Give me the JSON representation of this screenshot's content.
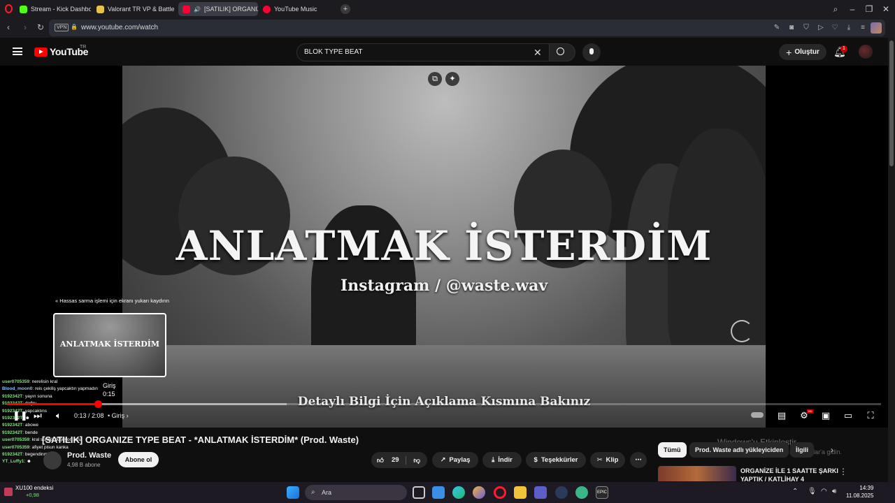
{
  "browser": {
    "tabs": [
      {
        "label": "Stream - Kick Dashboard",
        "color": "#53fc18",
        "active": false
      },
      {
        "label": "Valorant TR VP & Battle Pa",
        "color": "#e8c14a",
        "active": false
      },
      {
        "label": "[SATILIK] ORGANIZE T",
        "color": "#ff0033",
        "active": true
      },
      {
        "label": "YouTube Music",
        "color": "#ff0033",
        "active": false
      }
    ],
    "vpn_label": "VPN",
    "url": "www.youtube.com/watch"
  },
  "youtube": {
    "logo_text": "YouTube",
    "country": "TR",
    "search_value": "BLOK TYPE BEAT",
    "create_label": "Oluştur",
    "notification_count": "1"
  },
  "video": {
    "title_overlay": "ANLATMAK İSTERDİM",
    "subtitle_overlay": "Instagram / @waste.wav",
    "footer_overlay": "Detaylı Bilgi İçin Açıklama Kısmına Bakınız",
    "preview_hint": "Hassas sarma işlemi için ekranı yukarı kaydırın",
    "preview_title": "ANLATMAK İSTERDİM",
    "preview_chapter": "Giriş",
    "preview_time": "0:15",
    "current_time": "0:13 / 2:08",
    "chapter": "Giriş",
    "progress": 0.104,
    "buffered": 0.32
  },
  "chat": [
    {
      "user": "user0705359",
      "msg": ": nerelisin kral",
      "color": "#7ee37e"
    },
    {
      "user": "Blood_moon0",
      "msg": ": reis çekiliş yapcaktın yapmadın",
      "color": "#7ec8ff"
    },
    {
      "user": "9192342T",
      "msg": ": yayın sonuna",
      "color": "#7ee37e"
    },
    {
      "user": "9192342T",
      "msg": ": doğru",
      "color": "#7ee37e"
    },
    {
      "user": "9192342T",
      "msg": ": yapcaktıns",
      "color": "#7ee37e"
    },
    {
      "user": "9192342T",
      "msg": ": ☻",
      "color": "#7ee37e"
    },
    {
      "user": "9192342T",
      "msg": ": abowe",
      "color": "#7ee37e"
    },
    {
      "user": "9192342T",
      "msg": ": bende",
      "color": "#7ee37e"
    },
    {
      "user": "user0705359",
      "msg": ": kral sürekli düşüyon ama",
      "color": "#7ee37e"
    },
    {
      "user": "user0705359",
      "msg": ": afiyet pisun kanka",
      "color": "#7ee37e"
    },
    {
      "user": "9192342T",
      "msg": ": begendinmi",
      "color": "#7ee37e"
    },
    {
      "user": "YT_Luffy1",
      "msg": ": ☻",
      "color": "#7ee37e"
    }
  ],
  "meta": {
    "title": "[SATILIK] ORGANIZE TYPE BEAT - *ANLATMAK İSTERDİM* (Prod. Waste)",
    "channel": "Prod. Waste",
    "subscribers": "4,98 B abone",
    "subscribe_label": "Abone ol",
    "likes": "29",
    "share_label": "Paylaş",
    "download_label": "İndir",
    "thanks_label": "Teşekkürler",
    "clip_label": "Klip"
  },
  "sidebar": {
    "chips": [
      "Tümü",
      "Prod. Waste adlı yükleyiciden",
      "İlgili"
    ],
    "recommend_title": "ORGANİZE İLE 1 SAATTE ŞARKI YAPTIK / KATLİHAY 4",
    "windows_watermark": "Windows'u Etkinleştir",
    "windows_watermark_sub": "Windows'u etkinleştirmek için Ayarlar'a gidin."
  },
  "taskbar": {
    "ticker_title": "XU100 endeksi",
    "ticker_value": "+0,98",
    "search_label": "Ara",
    "time": "14:39",
    "date": "11.08.2025"
  }
}
